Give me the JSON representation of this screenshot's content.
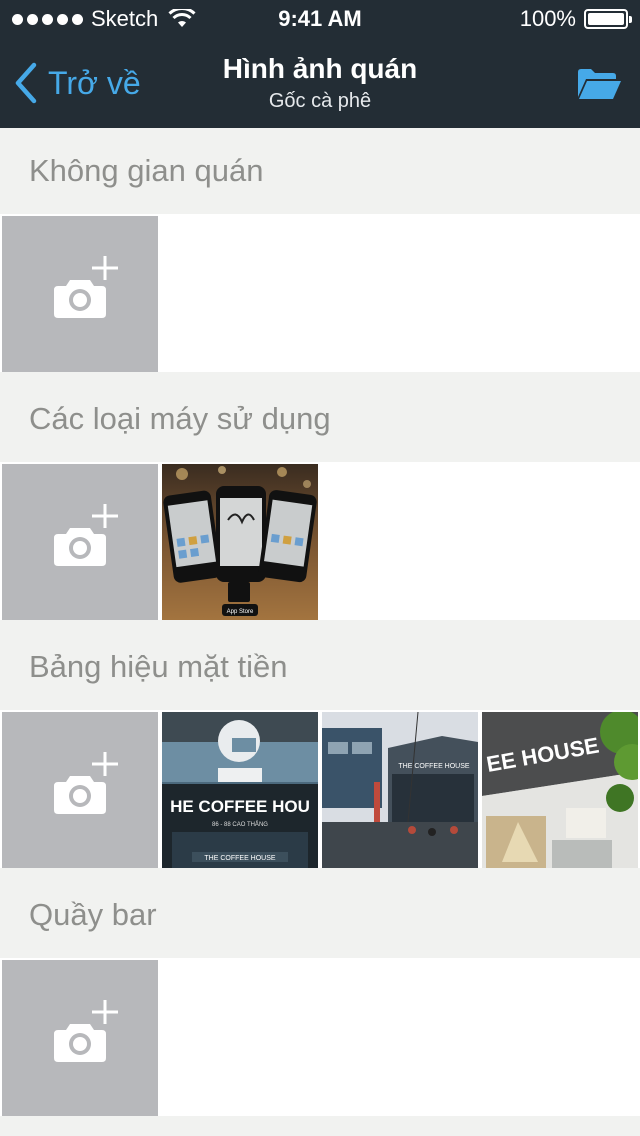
{
  "status_bar": {
    "carrier": "Sketch",
    "time": "9:41 AM",
    "battery": "100%"
  },
  "nav": {
    "back_label": "Trở về",
    "title": "Hình ảnh quán",
    "subtitle": "Gốc cà phê"
  },
  "sections": [
    {
      "title": "Không gian quán",
      "photo_count": 0
    },
    {
      "title": "Các loại máy sử dụng",
      "photo_count": 1
    },
    {
      "title": "Bảng hiệu mặt tiền",
      "photo_count": 3
    },
    {
      "title": "Quầy bar",
      "photo_count": 0
    }
  ],
  "photos": {
    "phones": {
      "app_store_badge": "App Store"
    },
    "coffee_house_1": {
      "sign": "HE COFFEE HOU",
      "address": "86 - 88 CAO THẮNG",
      "lower_sign": "THE COFFEE HOUSE"
    },
    "coffee_house_2": {
      "sign": "THE COFFEE HOUSE"
    },
    "coffee_house_3": {
      "sign": "EE HOUSE"
    }
  },
  "icons": {
    "back": "chevron-left-icon",
    "folder": "folder-open-icon",
    "add_photo": "camera-plus-icon"
  },
  "colors": {
    "header": "#232d35",
    "accent": "#46a9e8",
    "tile": "#b7b8bb",
    "section_bg": "#f1f2f0"
  }
}
